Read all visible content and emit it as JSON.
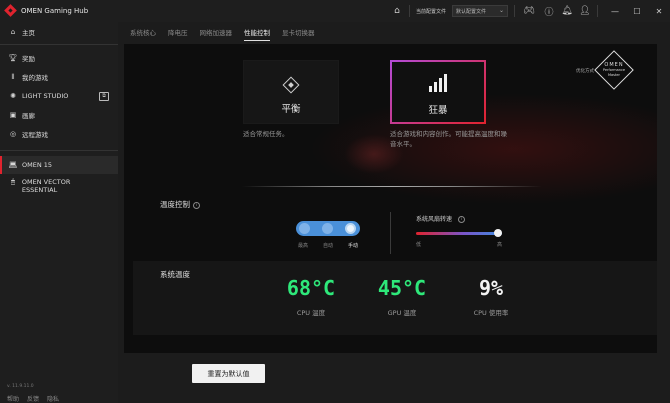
{
  "app": {
    "title": "OMEN Gaming Hub"
  },
  "titlebar": {
    "profile_label": "当前配置文件",
    "profile_select": "默认配置文件"
  },
  "sidebar": {
    "items": [
      {
        "label": "主页",
        "icon": "home-icon"
      },
      {
        "label": "奖励",
        "icon": "trophy-icon"
      },
      {
        "label": "我的游戏",
        "icon": "library-icon"
      },
      {
        "label": "LIGHT STUDIO",
        "icon": "lightbulb-icon"
      },
      {
        "label": "画廊",
        "icon": "gallery-icon"
      },
      {
        "label": "远程游戏",
        "icon": "remote-play-icon"
      }
    ],
    "devices": [
      {
        "label": "OMEN 15"
      },
      {
        "label": "OMEN VECTOR ESSENTIAL"
      }
    ],
    "version": "v. 11.9.11.0",
    "footer": [
      "帮助",
      "反馈",
      "隐私"
    ]
  },
  "tabs": [
    "系统核心",
    "降电压",
    "网络加速器",
    "性能控制",
    "显卡切换器"
  ],
  "active_tab": "性能控制",
  "modes": {
    "balance": {
      "label": "平衡",
      "desc": "适合常规任务。"
    },
    "performance": {
      "label": "狂暴",
      "desc": "适合游戏和内容创作。可能提高温度和噪音水平。"
    }
  },
  "omen_badge": {
    "label": "优化方式",
    "text_line1": "OMEN",
    "text_line2": "Performance",
    "text_line3": "Master"
  },
  "temp_control": {
    "title": "温度控制",
    "options": [
      "最高",
      "自动",
      "手动"
    ],
    "selected": "手动"
  },
  "fan": {
    "title": "系统风扇转速",
    "low": "低",
    "high": "高",
    "level": 0.95
  },
  "system_temp": {
    "title": "系统温度",
    "readings": [
      {
        "value": "68°C",
        "label": "CPU 温度",
        "color": "#2ee87a"
      },
      {
        "value": "45°C",
        "label": "GPU 温度",
        "color": "#2ee87a"
      },
      {
        "value": "9%",
        "label": "CPU 使用率",
        "color": "#f2f2f2"
      }
    ]
  },
  "reset_button": "重置为默认值",
  "colors": {
    "accent_red": "#e0232e",
    "temp_green": "#2ee87a",
    "toggle_blue": "#4a90d9"
  }
}
